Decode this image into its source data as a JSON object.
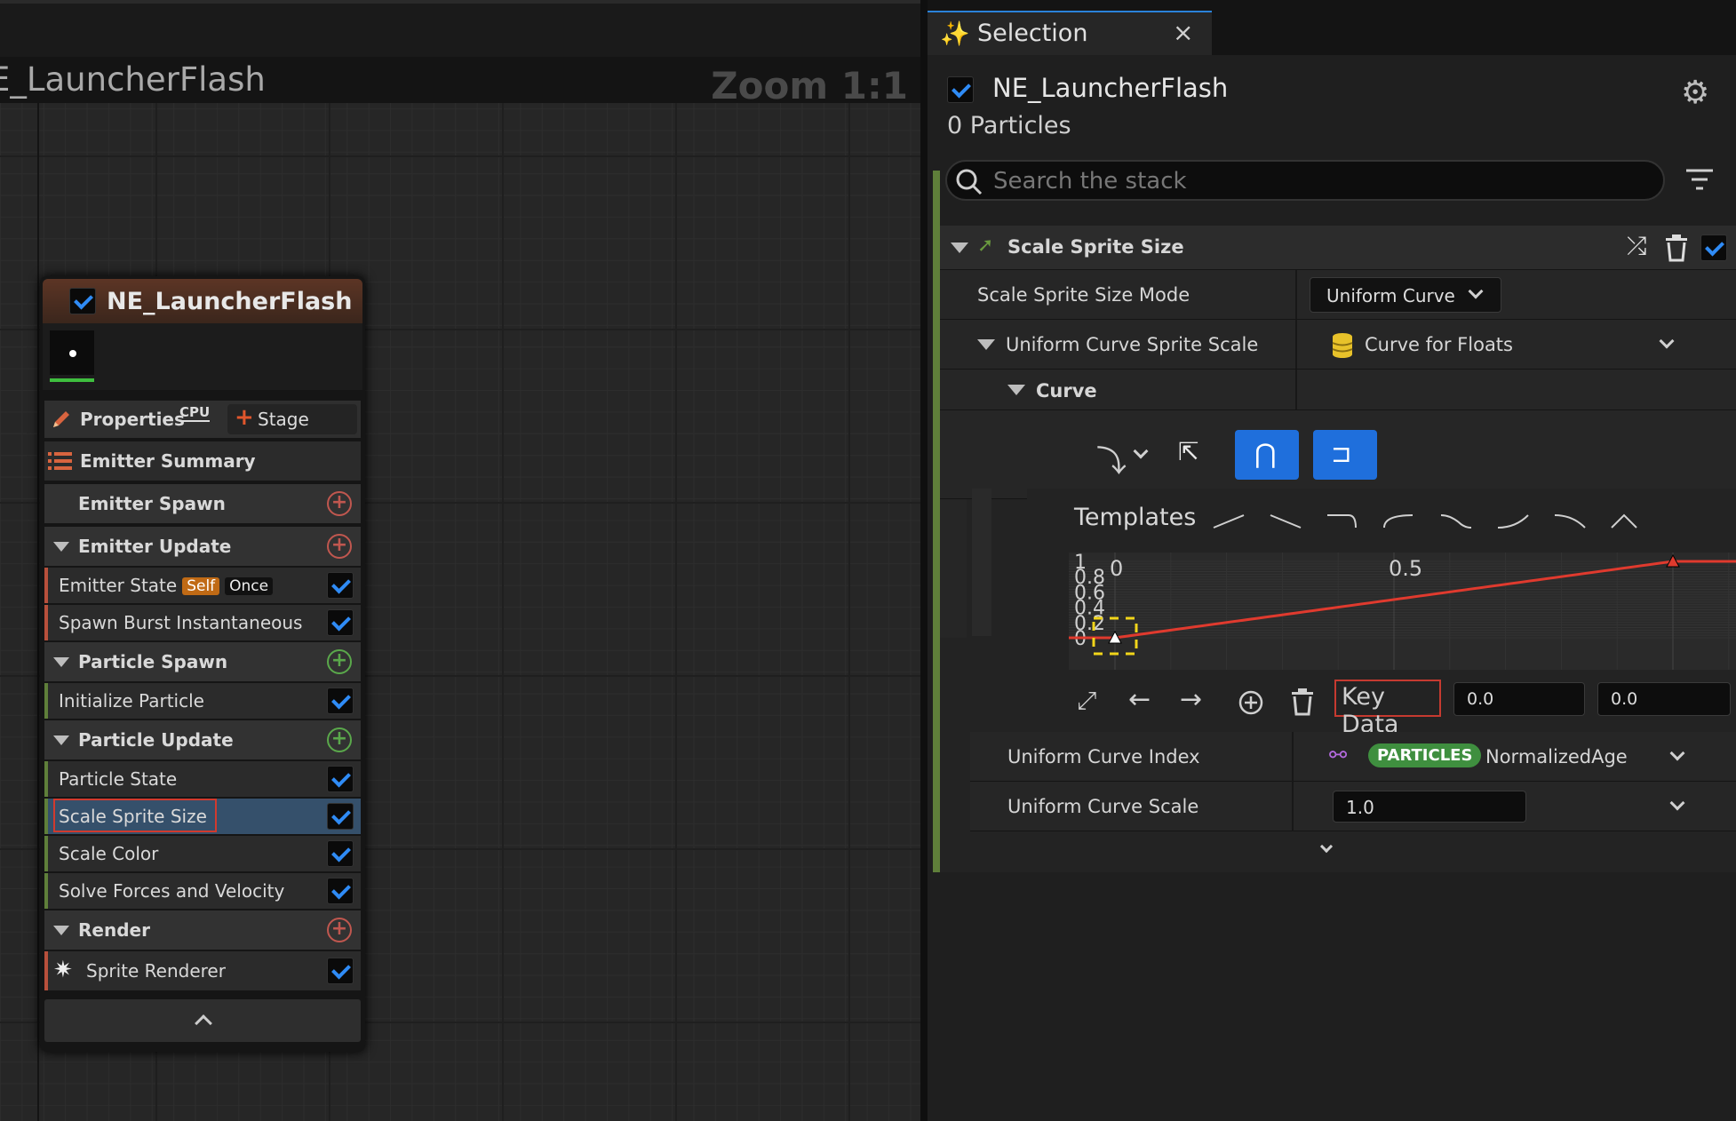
{
  "graph": {
    "title": "E_LauncherFlash",
    "zoom": "Zoom 1:1"
  },
  "node": {
    "title": "NE_LauncherFlash",
    "properties_label": "Properties",
    "cpu_badge": "CPU",
    "stage_label": "Stage",
    "rows": [
      {
        "label": "Emitter Summary"
      },
      {
        "label": "Emitter Spawn"
      },
      {
        "label": "Emitter Update"
      },
      {
        "label": "Emitter State",
        "tag_self": "Self",
        "tag_once": "Once"
      },
      {
        "label": "Spawn Burst Instantaneous"
      },
      {
        "label": "Particle Spawn"
      },
      {
        "label": "Initialize Particle"
      },
      {
        "label": "Particle Update"
      },
      {
        "label": "Particle State"
      },
      {
        "label": "Scale Sprite Size"
      },
      {
        "label": "Scale Color"
      },
      {
        "label": "Solve Forces and Velocity"
      },
      {
        "label": "Render"
      },
      {
        "label": "Sprite Renderer"
      }
    ]
  },
  "panel": {
    "tab_title": "Selection",
    "tab_close": "×",
    "emitter_name": "NE_LauncherFlash",
    "particle_count": "0 Particles",
    "search_placeholder": "Search the stack",
    "module_title": "Scale Sprite Size",
    "props": {
      "mode_label": "Scale Sprite Size Mode",
      "mode_value": "Uniform Curve",
      "curve_scale_label": "Uniform Curve Sprite Scale",
      "curve_scale_value": "Curve for Floats",
      "curve_label": "Curve",
      "templates_label": "Templates",
      "key_data_label": "Key Data",
      "key_time": "0.0",
      "key_value": "0.0",
      "index_label": "Uniform Curve Index",
      "index_pill": "PARTICLES",
      "index_value": "NormalizedAge",
      "scale_label": "Uniform Curve Scale",
      "scale_value": "1.0"
    }
  },
  "chart_data": {
    "type": "line",
    "x_ticks": [
      "0",
      "0.5"
    ],
    "y_ticks": [
      "1",
      "0.8",
      "0.6",
      "0.4",
      "0.2",
      "0"
    ],
    "series": [
      {
        "x": [
          0,
          1
        ],
        "y": [
          0,
          1
        ]
      }
    ],
    "curve_color": "#e03a2e"
  },
  "colors": {
    "accent_blue": "#1f6fdc",
    "check_blue": "#2f8bf5",
    "highlight_red": "#d13a2e",
    "stack_green": "#5f7f3a"
  }
}
